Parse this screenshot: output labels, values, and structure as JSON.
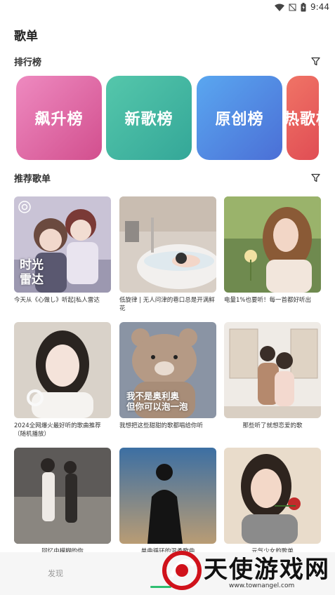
{
  "status_bar": {
    "time": "9:44"
  },
  "page": {
    "title": "歌单"
  },
  "sections": {
    "ranking": {
      "title": "排行榜"
    },
    "recommend": {
      "title": "推荐歌单"
    }
  },
  "ranking_cards": [
    {
      "label": "飙升榜",
      "color_from": "#ee8ac0",
      "color_to": "#d24f8e"
    },
    {
      "label": "新歌榜",
      "color_from": "#55c7ab",
      "color_to": "#34a798"
    },
    {
      "label": "原创榜",
      "color_from": "#5aa7f0",
      "color_to": "#4b6fd6"
    },
    {
      "label": "热歌榜",
      "color_from": "#f07466",
      "color_to": "#e04d54"
    }
  ],
  "playlists": [
    {
      "caption": "今天从《心做し》听起|私人雷达",
      "overlay": [
        "时光",
        "雷达"
      ],
      "icon": "radar-logo-icon"
    },
    {
      "caption": "低旋律 | 无人问津的巷口总是开满鲜花",
      "overlay": []
    },
    {
      "caption": "电量1%也要听！每一首都好听出",
      "overlay": []
    },
    {
      "caption": "2024全网爆火最好听的歌曲推荐（随机播放）",
      "overlay": []
    },
    {
      "caption": "我想把这些甜甜的歌都唱给你听",
      "overlay": [
        "我不是奥利奥",
        "但你可以泡一泡"
      ]
    },
    {
      "caption": "那些听了就想恋爱的歌",
      "overlay": []
    },
    {
      "caption": "回忆中模糊的你",
      "overlay": []
    },
    {
      "caption": "单曲循环的温柔歌曲",
      "overlay": []
    },
    {
      "caption": "元气少女的歌单",
      "overlay": []
    }
  ],
  "bottom_nav": {
    "discover_label": "发现"
  },
  "watermark": {
    "text": "天使游戏网",
    "url": "www.townangel.com"
  }
}
